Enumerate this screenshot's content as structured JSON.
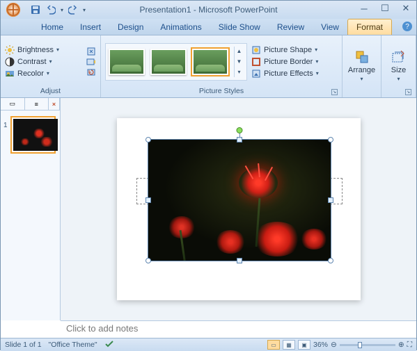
{
  "title": "Presentation1 - Microsoft PowerPoint",
  "tabs": {
    "home": "Home",
    "insert": "Insert",
    "design": "Design",
    "animations": "Animations",
    "slideshow": "Slide Show",
    "review": "Review",
    "view": "View",
    "format": "Format"
  },
  "ribbon": {
    "adjust": {
      "brightness": "Brightness",
      "contrast": "Contrast",
      "recolor": "Recolor",
      "label": "Adjust"
    },
    "styles": {
      "shape": "Picture Shape",
      "border": "Picture Border",
      "effects": "Picture Effects",
      "label": "Picture Styles"
    },
    "arrange": {
      "label": "Arrange"
    },
    "size": {
      "label": "Size"
    }
  },
  "notes_placeholder": "Click to add notes",
  "status": {
    "slide": "Slide 1 of 1",
    "theme": "\"Office Theme\"",
    "zoom": "36%"
  }
}
